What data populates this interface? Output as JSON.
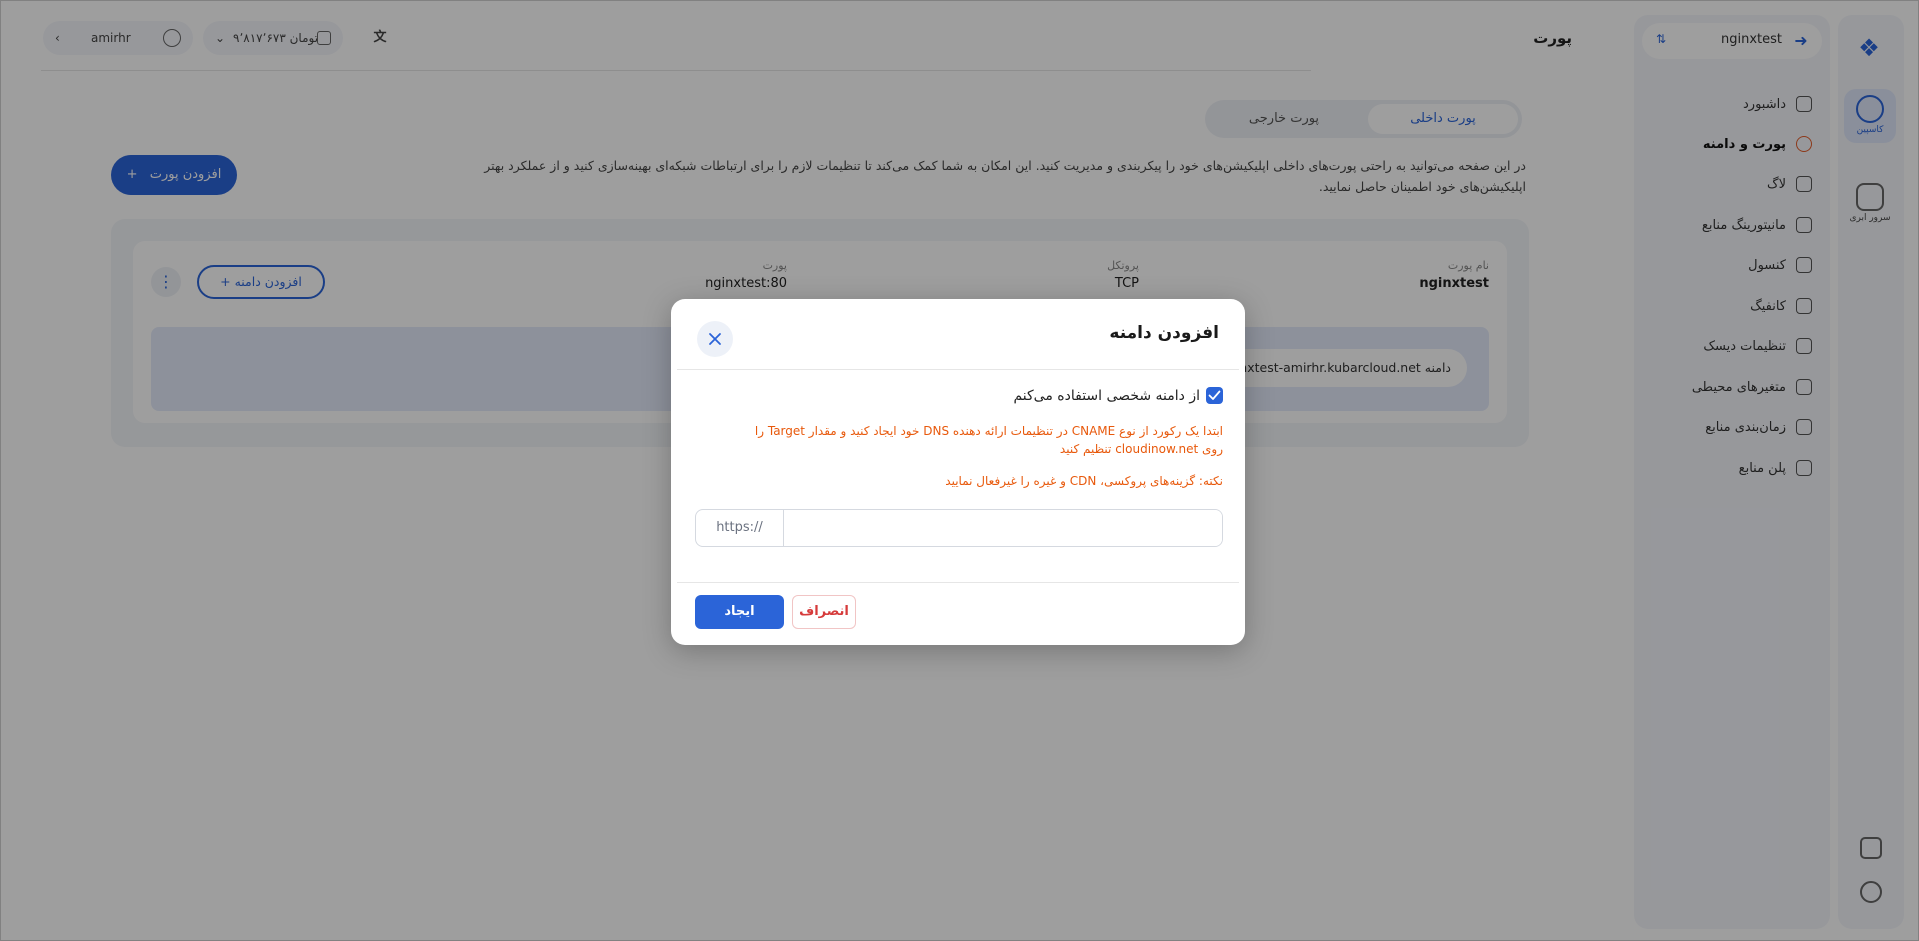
{
  "rail": {
    "items": [
      {
        "label": "کاسپین"
      },
      {
        "label": "سرور ابری"
      }
    ]
  },
  "sidebar": {
    "project": "nginxtest",
    "items": [
      {
        "label": "داشبورد"
      },
      {
        "label": "پورت و دامنه"
      },
      {
        "label": "لاگ"
      },
      {
        "label": "مانیتورینگ منابع"
      },
      {
        "label": "کنسول"
      },
      {
        "label": "کانفیگ"
      },
      {
        "label": "تنظیمات دیسک"
      },
      {
        "label": "متغیرهای محیطی"
      },
      {
        "label": "زمان‌بندی منابع"
      },
      {
        "label": "پلن منابع"
      }
    ]
  },
  "header": {
    "page_title": "پورت",
    "user": "amirhr",
    "balance": "۹٬۸۱۷٬۶۷۳ تومان"
  },
  "tabs": [
    {
      "label": "پورت داخلی"
    },
    {
      "label": "پورت خارجی"
    }
  ],
  "description": "در این صفحه می‌توانید به راحتی پورت‌های داخلی اپلیکیشن‌های خود را پیکربندی و مدیریت کنید. این امکان به شما کمک می‌کند تا تنظیمات لازم را برای ارتباطات شبکه‌ای بهینه‌سازی کنید و از عملکرد بهتر اپلیکیشن‌های خود اطمینان حاصل نمایید.",
  "add_port_label": "افزودن پورت",
  "port_card": {
    "name_label": "نام پورت",
    "name_value": "nginxtest",
    "protocol_label": "پروتکل",
    "protocol_value": "TCP",
    "port_label": "پورت",
    "port_value": "nginxtest:80",
    "add_domain_label": "افزودن دامنه",
    "domain_chip": "دامنه nginxtest-amirhr.kubarcloud.net"
  },
  "modal": {
    "title": "افزودن دامنه",
    "checkbox_label": "از دامنه شخصی استفاده می‌کنم",
    "warning_line1": "ابتدا یک رکورد از نوع CNAME در تنظیمات ارائه دهنده DNS خود ایجاد کنید و مقدار Target را روی cloudinow.net تنظیم کنید",
    "warning_line2": "نکته: گزینه‌های پروکسی، CDN و غیره را غیرفعال نمایید",
    "url_prefix": "https://",
    "url_value": "",
    "cancel_label": "انصراف",
    "create_label": "ایجاد"
  },
  "colors": {
    "accent": "#2b64d8",
    "warning": "#e8590c",
    "danger": "#d63b3b"
  }
}
